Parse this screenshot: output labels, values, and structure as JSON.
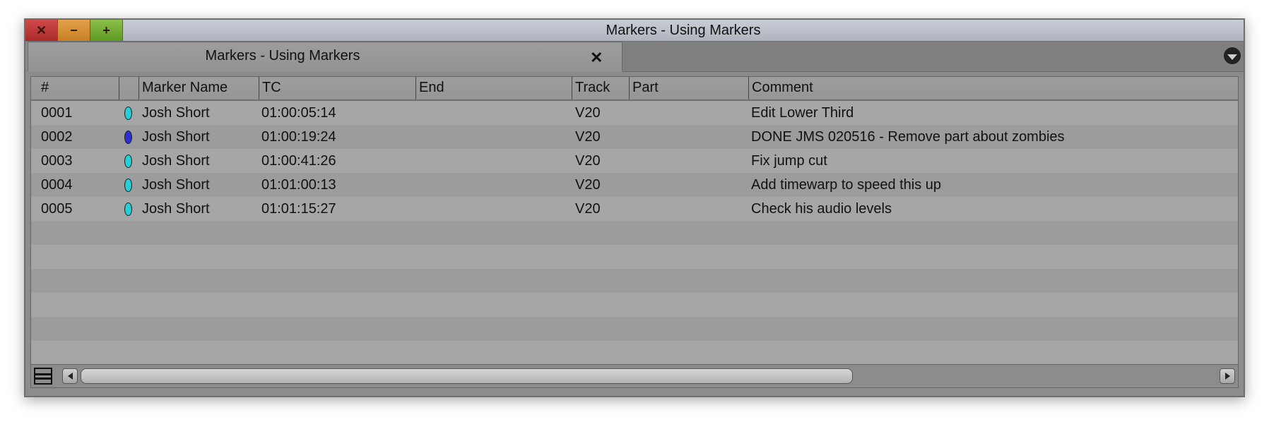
{
  "window": {
    "title": "Markers - Using Markers",
    "buttons": {
      "close": "✕",
      "minimize": "−",
      "maximize": "+"
    }
  },
  "tab": {
    "label": "Markers - Using Markers",
    "close": "✕"
  },
  "columns": {
    "num": "#",
    "marker_name": "Marker Name",
    "tc": "TC",
    "end": "End",
    "track": "Track",
    "part": "Part",
    "comment": "Comment"
  },
  "colors": {
    "cyan_marker": "#22d0d6",
    "blue_marker": "#2d2fd0"
  },
  "rows": [
    {
      "num": "0001",
      "marker_color": "cyan",
      "name": "Josh Short",
      "tc": "01:00:05:14",
      "end": "",
      "track": "V20",
      "part": "",
      "comment": "Edit Lower Third"
    },
    {
      "num": "0002",
      "marker_color": "blue",
      "name": "Josh Short",
      "tc": "01:00:19:24",
      "end": "",
      "track": "V20",
      "part": "",
      "comment": "DONE JMS 020516 - Remove part about zombies"
    },
    {
      "num": "0003",
      "marker_color": "cyan",
      "name": "Josh Short",
      "tc": "01:00:41:26",
      "end": "",
      "track": "V20",
      "part": "",
      "comment": "Fix jump cut"
    },
    {
      "num": "0004",
      "marker_color": "cyan",
      "name": "Josh Short",
      "tc": "01:01:00:13",
      "end": "",
      "track": "V20",
      "part": "",
      "comment": "Add timewarp to speed this up"
    },
    {
      "num": "0005",
      "marker_color": "cyan",
      "name": "Josh Short",
      "tc": "01:01:15:27",
      "end": "",
      "track": "V20",
      "part": "",
      "comment": "Check his audio levels"
    }
  ],
  "empty_rows": 6,
  "scrollbar": {
    "thumb_fraction": 0.68
  }
}
